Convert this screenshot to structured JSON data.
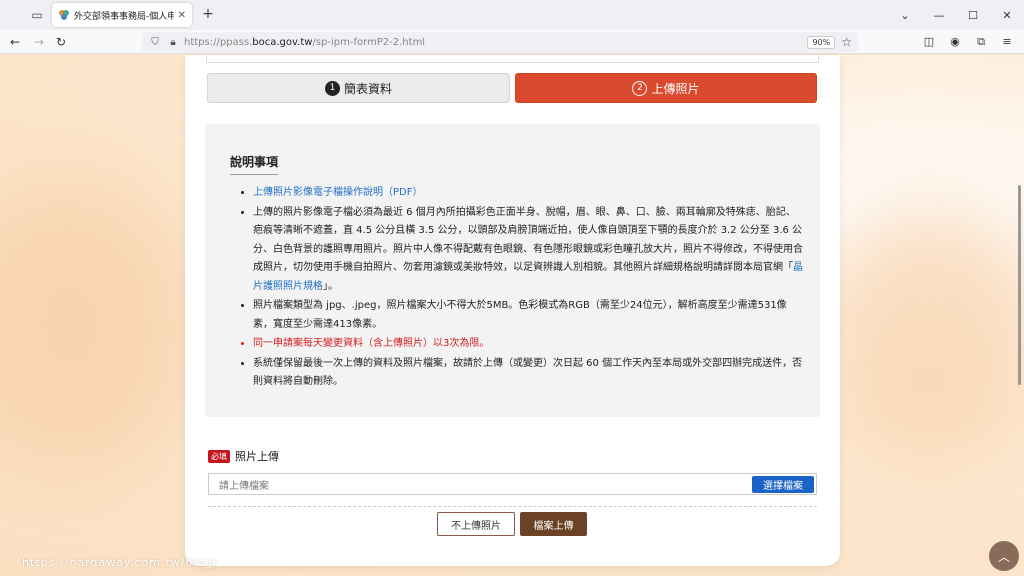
{
  "browser": {
    "tab_title": "外交部領事事務局-個人申辦護",
    "new_tab": "+",
    "url_prefix": "https://ppass.",
    "url_domain": "boca.gov.tw",
    "url_path": "/sp-ipm-formP2-2.html",
    "zoom": "90%"
  },
  "steps": {
    "step1_num": "1",
    "step1_label": "簡表資料",
    "step2_num": "2",
    "step2_label": "上傳照片"
  },
  "notes": {
    "title": "說明事項",
    "item1_link": "上傳照片影像電子檔操作說明（PDF）",
    "item2_text": "上傳的照片影像電子檔必須為最近 6 個月內所拍攝彩色正面半身、脫帽，眉、眼、鼻、口、臉、兩耳輪廓及特殊痣、胎記、疤痕等清晰不遮蓋，直 4.5 公分且橫 3.5 公分，以頭部及肩膀頂端近拍，使人像自頭頂至下顎的長度介於 3.2 公分至 3.6 公分、白色背景的護照專用照片。照片中人像不得配戴有色眼鏡、有色隱形眼鏡或彩色瞳孔放大片，照片不得修改，不得使用合成照片，切勿使用手機自拍照片、勿套用濾鏡或美妝特效，以足資辨識人別相貌。其他照片詳細規格說明請詳閱本局官網「",
    "item2_link": "晶片護照照片規格",
    "item2_end": "」。",
    "item3_text": "照片檔案類型為 jpg、.jpeg，照片檔案大小不得大於5MB。色彩模式為RGB（需至少24位元），解析高度至少需達531像素，寬度至少需達413像素。",
    "item4_text": "同一申請案每天變更資料（含上傳照片）以3次為限。",
    "item5_text": "系統僅保留最後一次上傳的資料及照片檔案，故請於上傳（或變更）次日起 60 個工作天內至本局或外交部四辦完成送件，否則資料將自動刪除。"
  },
  "upload": {
    "required_badge": "必填",
    "label": "照片上傳",
    "placeholder": "請上傳檔案",
    "choose_button": "選擇檔案"
  },
  "buttons": {
    "no_upload": "不上傳照片",
    "upload": "檔案上傳"
  },
  "watermark": "https://hardaway.com.tw/blog/",
  "colors": {
    "accent_red": "#d94a2e",
    "brown": "#6b4226",
    "blue": "#1a63c7",
    "required_red": "#c4161c"
  }
}
